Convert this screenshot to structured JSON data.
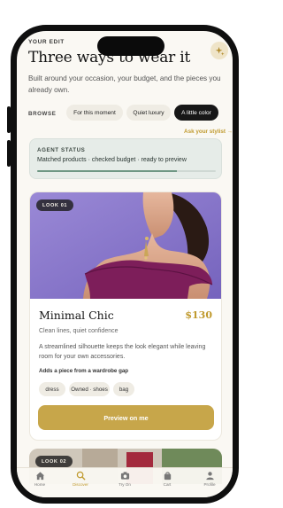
{
  "header": {
    "eyebrow": "YOUR EDIT",
    "title": "Three ways to wear it",
    "subtitle": "Built around your occasion, your budget, and the pieces you already own."
  },
  "browse": {
    "label": "BROWSE",
    "chips": [
      {
        "label": "For this moment",
        "active": false
      },
      {
        "label": "Quiet luxury",
        "active": false
      },
      {
        "label": "A little color",
        "active": true
      }
    ],
    "ask_link": "Ask your stylist →"
  },
  "agent_status": {
    "title": "AGENT STATUS",
    "text": "Matched products · checked budget · ready to preview",
    "progress": 0.78
  },
  "look": {
    "badge": "LOOK 01",
    "title": "Minimal Chic",
    "price": "$130",
    "subtitle": "Clean lines, quiet confidence",
    "description": "A streamlined silhouette keeps the look elegant while leaving room for your own accessories.",
    "note": "Adds a piece from a wardrobe gap",
    "tags": [
      "dress",
      "Owned · shoes",
      "bag"
    ],
    "cta": "Preview on me"
  },
  "next_look": {
    "badge": "LOOK 02"
  },
  "tabbar": {
    "items": [
      {
        "label": "Home",
        "icon": "home-icon",
        "active": false
      },
      {
        "label": "Discover",
        "icon": "search-icon",
        "active": true
      },
      {
        "label": "Try On",
        "icon": "camera-icon",
        "active": false
      },
      {
        "label": "Cart",
        "icon": "bag-icon",
        "active": false
      },
      {
        "label": "Profile",
        "icon": "person-icon",
        "active": false
      }
    ]
  },
  "colors": {
    "accent_gold": "#c7a64a",
    "dress_magenta": "#7d1e5a",
    "photo_backdrop": "#8a78c9",
    "status_bg": "#e6ece8"
  }
}
